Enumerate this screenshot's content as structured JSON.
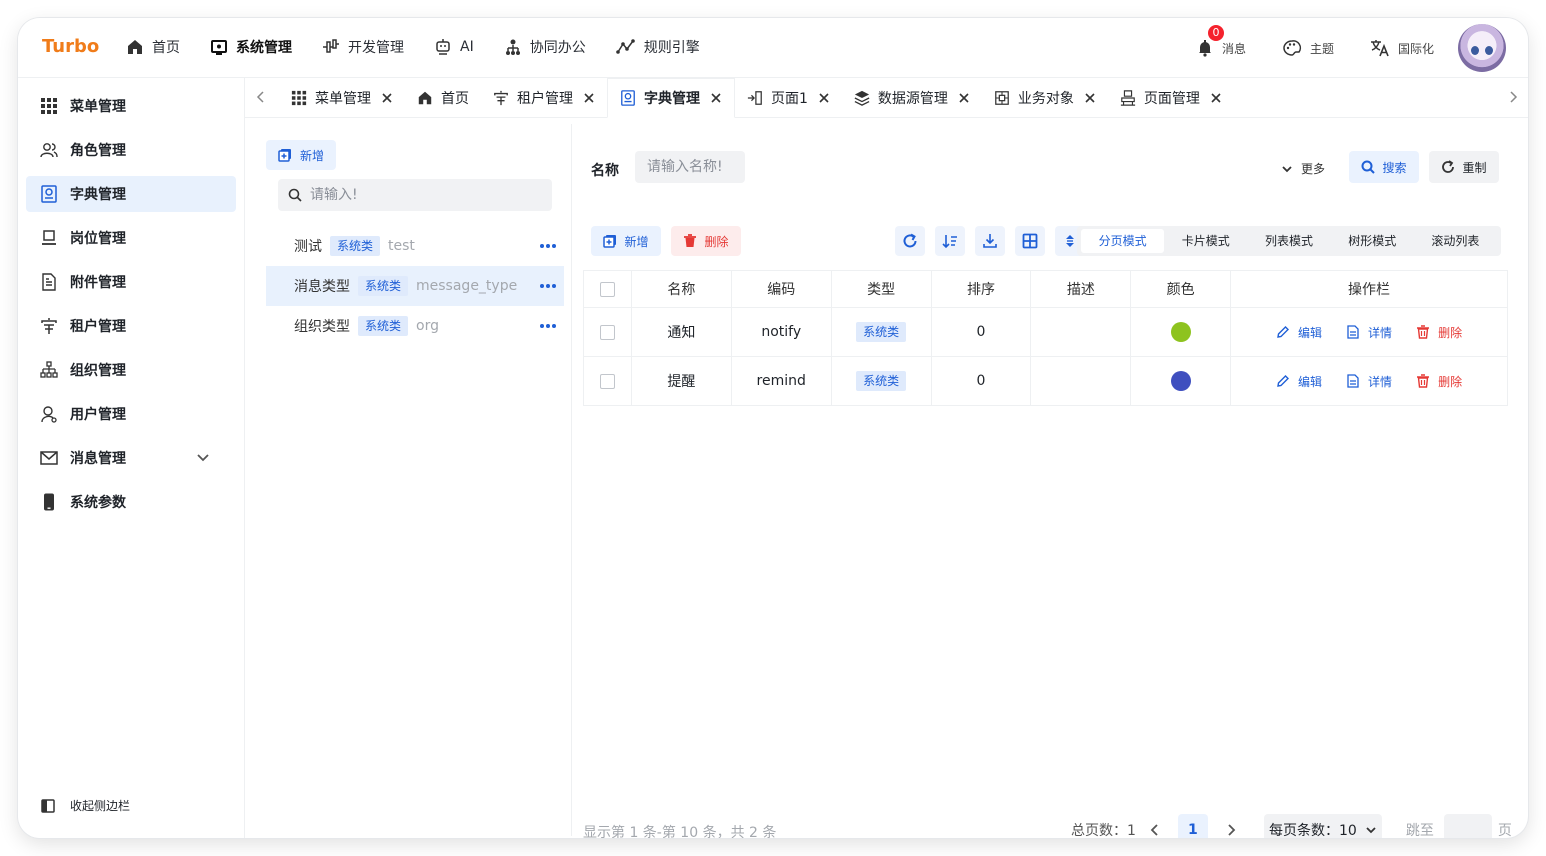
{
  "app": {
    "logo": "Turbo"
  },
  "topnav": [
    {
      "label": "首页",
      "icon": "home-icon"
    },
    {
      "label": "系统管理",
      "icon": "monitor-icon",
      "active": true
    },
    {
      "label": "开发管理",
      "icon": "dev-icon"
    },
    {
      "label": "AI",
      "icon": "robot-icon"
    },
    {
      "label": "协同办公",
      "icon": "org-icon"
    },
    {
      "label": "规则引擎",
      "icon": "rule-icon"
    }
  ],
  "header_right": {
    "messages": "消息",
    "message_count": "0",
    "theme": "主题",
    "i18n": "国际化"
  },
  "sidebar": {
    "items": [
      {
        "label": "菜单管理",
        "icon": "grid-icon"
      },
      {
        "label": "角色管理",
        "icon": "users-icon"
      },
      {
        "label": "字典管理",
        "icon": "dictionary-icon",
        "active": true
      },
      {
        "label": "岗位管理",
        "icon": "post-icon"
      },
      {
        "label": "附件管理",
        "icon": "file-icon"
      },
      {
        "label": "租户管理",
        "icon": "tenant-icon"
      },
      {
        "label": "组织管理",
        "icon": "org-tree-icon"
      },
      {
        "label": "用户管理",
        "icon": "user-icon"
      },
      {
        "label": "消息管理",
        "icon": "mail-icon",
        "expandable": true
      },
      {
        "label": "系统参数",
        "icon": "phone-icon"
      }
    ],
    "collapse_label": "收起侧边栏"
  },
  "tabs": [
    {
      "label": "菜单管理",
      "icon": "grid-icon"
    },
    {
      "label": "首页",
      "icon": "home-icon"
    },
    {
      "label": "租户管理",
      "icon": "tenant-icon"
    },
    {
      "label": "字典管理",
      "icon": "dictionary-icon",
      "active": true
    },
    {
      "label": "页面1",
      "icon": "page-icon"
    },
    {
      "label": "数据源管理",
      "icon": "layers-icon"
    },
    {
      "label": "业务对象",
      "icon": "object-icon"
    },
    {
      "label": "页面管理",
      "icon": "page-manage-icon"
    }
  ],
  "left_panel": {
    "new_label": "新增",
    "search_placeholder": "请输入!",
    "items": [
      {
        "name": "测试",
        "tag": "系统类",
        "code": "test"
      },
      {
        "name": "消息类型",
        "tag": "系统类",
        "code": "message_type",
        "active": true
      },
      {
        "name": "组织类型",
        "tag": "系统类",
        "code": "org"
      }
    ]
  },
  "filter": {
    "name_label": "名称",
    "name_placeholder": "请输入名称!",
    "more_label": "更多",
    "search_label": "搜索",
    "reset_label": "重制"
  },
  "toolbar": {
    "new_label": "新增",
    "delete_label": "删除",
    "modes": [
      "分页模式",
      "卡片模式",
      "列表模式",
      "树形模式",
      "滚动列表"
    ],
    "active_mode": "分页模式"
  },
  "table": {
    "headers": [
      "名称",
      "编码",
      "类型",
      "排序",
      "描述",
      "颜色",
      "操作栏"
    ],
    "rows": [
      {
        "name": "通知",
        "code": "notify",
        "type": "系统类",
        "sort": "0",
        "desc": "",
        "color": "#8ec31f"
      },
      {
        "name": "提醒",
        "code": "remind",
        "type": "系统类",
        "sort": "0",
        "desc": "",
        "color": "#3f4fbf"
      }
    ],
    "actions": {
      "edit": "编辑",
      "detail": "详情",
      "delete": "删除"
    }
  },
  "pagination": {
    "summary": "显示第 1 条-第 10 条，共 2 条",
    "total_pages_label": "总页数：1",
    "current_page": "1",
    "page_size_label": "每页条数：10",
    "jump_label": "跳至",
    "page_suffix": "页"
  },
  "colors": {
    "accent": "#1f5fd6",
    "brand": "#f07c1a",
    "danger": "#e53935"
  }
}
